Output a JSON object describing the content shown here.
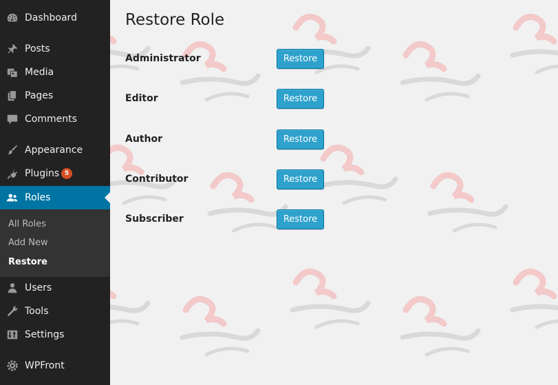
{
  "sidebar": {
    "items": [
      {
        "label": "Dashboard",
        "icon": "dashboard-icon"
      },
      {
        "label": "Posts",
        "icon": "pin-icon"
      },
      {
        "label": "Media",
        "icon": "media-icon"
      },
      {
        "label": "Pages",
        "icon": "pages-icon"
      },
      {
        "label": "Comments",
        "icon": "comment-icon"
      },
      {
        "label": "Appearance",
        "icon": "brush-icon"
      },
      {
        "label": "Plugins",
        "icon": "plug-icon",
        "badge": "5"
      },
      {
        "label": "Roles",
        "icon": "users-icon",
        "active": true
      },
      {
        "label": "Users",
        "icon": "user-icon"
      },
      {
        "label": "Tools",
        "icon": "wrench-icon"
      },
      {
        "label": "Settings",
        "icon": "settings-icon"
      },
      {
        "label": "WPFront",
        "icon": "gear-icon"
      }
    ],
    "submenu": [
      {
        "label": "All Roles"
      },
      {
        "label": "Add New"
      },
      {
        "label": "Restore",
        "current": true
      }
    ]
  },
  "page": {
    "title": "Restore Role",
    "roles": [
      {
        "name": "Administrator",
        "button": "Restore"
      },
      {
        "name": "Editor",
        "button": "Restore"
      },
      {
        "name": "Author",
        "button": "Restore"
      },
      {
        "name": "Contributor",
        "button": "Restore"
      },
      {
        "name": "Subscriber",
        "button": "Restore"
      }
    ]
  },
  "colors": {
    "sidebar_bg": "#222222",
    "active_bg": "#0074a2",
    "button_bg": "#2ea2cc",
    "badge_bg": "#d54e21",
    "page_bg": "#f1f1f1"
  }
}
